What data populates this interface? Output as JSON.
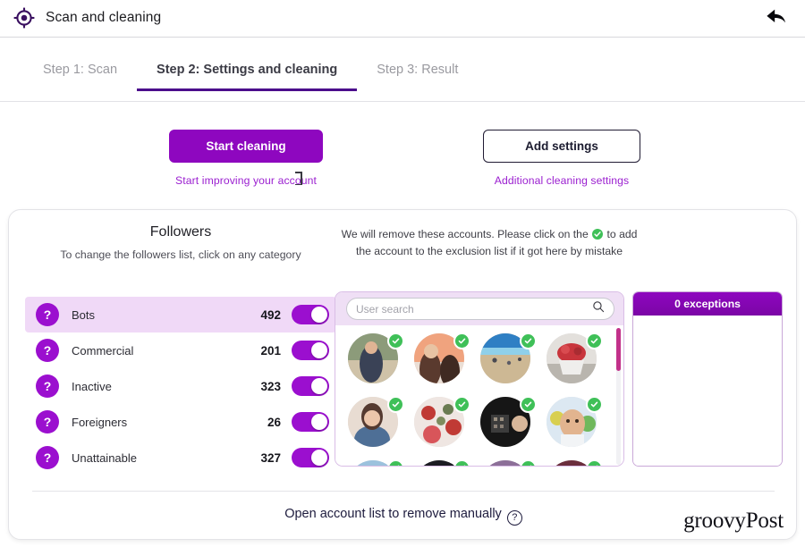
{
  "titlebar": {
    "app_title": "Scan and cleaning",
    "app_icon": "target-crosshair-icon",
    "back_icon": "back-arrow-icon"
  },
  "tabs": [
    {
      "label": "Step 1: Scan",
      "active": false
    },
    {
      "label": "Step 2: Settings and cleaning",
      "active": true
    },
    {
      "label": "Step 3: Result",
      "active": false
    }
  ],
  "actions": {
    "primary": {
      "label": "Start cleaning",
      "sub": "Start improving your account"
    },
    "secondary": {
      "label": "Add settings",
      "sub": "Additional cleaning settings"
    }
  },
  "card": {
    "followers": {
      "title": "Followers",
      "subtitle": "To change the followers list, click on any category"
    },
    "remove_note_line1": "We will remove these accounts. Please click on the",
    "remove_note_line2": "to add",
    "remove_note_line3": "the account to the exclusion list if it got here by mistake",
    "categories": [
      {
        "icon": "question-icon",
        "label": "Bots",
        "count": "492",
        "enabled": true,
        "selected": true
      },
      {
        "icon": "question-icon",
        "label": "Commercial",
        "count": "201",
        "enabled": true,
        "selected": false
      },
      {
        "icon": "question-icon",
        "label": "Inactive",
        "count": "323",
        "enabled": true,
        "selected": false
      },
      {
        "icon": "question-icon",
        "label": "Foreigners",
        "count": "26",
        "enabled": true,
        "selected": false
      },
      {
        "icon": "question-icon",
        "label": "Unattainable",
        "count": "327",
        "enabled": true,
        "selected": false
      }
    ],
    "search": {
      "placeholder": "User search",
      "value": "",
      "icon": "search-icon"
    },
    "accounts": {
      "check_icon": "green-check-icon",
      "avatars": [
        {
          "id": "avatar-1",
          "desc": "couple outdoors",
          "c1": "#8c9b7a",
          "c2": "#cfc2a8",
          "c3": "#3a4256"
        },
        {
          "id": "avatar-2",
          "desc": "two women",
          "c1": "#f0a37e",
          "c2": "#eadfd6",
          "c3": "#5a3a2e"
        },
        {
          "id": "avatar-3",
          "desc": "beach",
          "c1": "#2f7fc4",
          "c2": "#cdb894",
          "c3": "#8fd0ea"
        },
        {
          "id": "avatar-4",
          "desc": "strawberries",
          "c1": "#e3e0dc",
          "c2": "#c8353c",
          "c3": "#8c8f8a"
        },
        {
          "id": "avatar-5",
          "desc": "woman selfie",
          "c1": "#e8dcd2",
          "c2": "#4e6f96",
          "c3": "#553a30"
        },
        {
          "id": "avatar-6",
          "desc": "floral pattern",
          "c1": "#efe6e2",
          "c2": "#c03a35",
          "c3": "#6a7b52"
        },
        {
          "id": "avatar-7",
          "desc": "dark interior",
          "c1": "#161616",
          "c2": "#3c3c3c",
          "c3": "#9a8f80"
        },
        {
          "id": "avatar-8",
          "desc": "baby",
          "c1": "#dce8f2",
          "c2": "#e2b48f",
          "c3": "#d8cf50"
        },
        {
          "id": "avatar-9",
          "desc": "blue photo",
          "c1": "#9cc2dd",
          "c2": "#5c7f9e",
          "c3": "#e0e5ea"
        },
        {
          "id": "avatar-10",
          "desc": "dark photo",
          "c1": "#1c1c22",
          "c2": "#454550",
          "c3": "#7b7b88"
        },
        {
          "id": "avatar-11",
          "desc": "purple photo",
          "c1": "#8c6f98",
          "c2": "#cbb6d4",
          "c3": "#5c4368"
        },
        {
          "id": "avatar-12",
          "desc": "maroon photo",
          "c1": "#6b2e3d",
          "c2": "#a45a66",
          "c3": "#2e1620"
        }
      ],
      "scrollbar_color": "#c2318a"
    },
    "exceptions": {
      "title": "0 exceptions",
      "items": []
    },
    "footer": {
      "manual_link": "Open account list to remove manually",
      "help_icon": "question-circle-icon",
      "help_glyph": "?",
      "logo": "groovyPost"
    }
  },
  "colors": {
    "accent_purple": "#8e07bf",
    "dark_purple": "#4b0d8c",
    "link_purple": "#9b1fd0",
    "selected_row": "#f0d9f7",
    "check_green": "#3fc058",
    "scrollbar_pink": "#c2318a"
  }
}
